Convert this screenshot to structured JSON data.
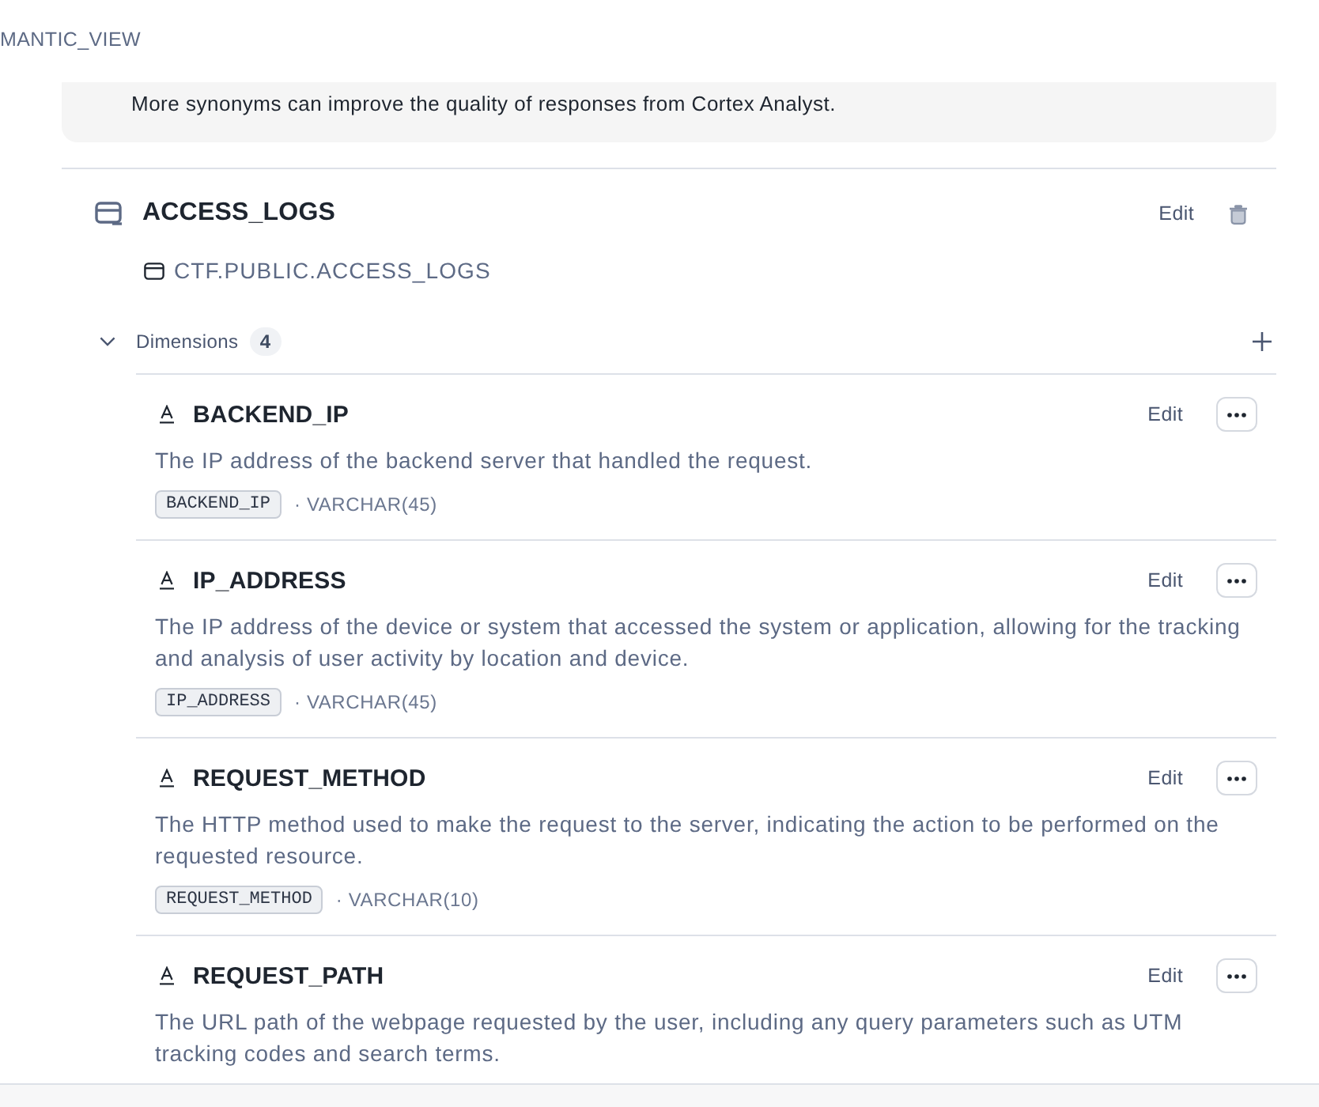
{
  "breadcrumb": {
    "text": "MANTIC_VIEW"
  },
  "info_card": {
    "text": "More synonyms can improve the quality of responses from Cortex Analyst."
  },
  "table": {
    "name": "ACCESS_LOGS",
    "edit_label": "Edit",
    "path": "CTF.PUBLIC.ACCESS_LOGS",
    "dimensions": {
      "label": "Dimensions",
      "count": "4",
      "expanded": true,
      "items": [
        {
          "name": "BACKEND_IP",
          "edit_label": "Edit",
          "description": "The IP address of the backend server that handled the request.",
          "column": "BACKEND_IP",
          "type": "· VARCHAR(45)"
        },
        {
          "name": "IP_ADDRESS",
          "edit_label": "Edit",
          "description": "The IP address of the device or system that accessed the system or application, allowing for the tracking and analysis of user activity by location and device.",
          "column": "IP_ADDRESS",
          "type": "· VARCHAR(45)"
        },
        {
          "name": "REQUEST_METHOD",
          "edit_label": "Edit",
          "description": "The HTTP method used to make the request to the server, indicating the action to be performed on the requested resource.",
          "column": "REQUEST_METHOD",
          "type": "· VARCHAR(10)"
        },
        {
          "name": "REQUEST_PATH",
          "edit_label": "Edit",
          "description": "The URL path of the webpage requested by the user, including any query parameters such as UTM tracking codes and search terms."
        }
      ]
    }
  }
}
